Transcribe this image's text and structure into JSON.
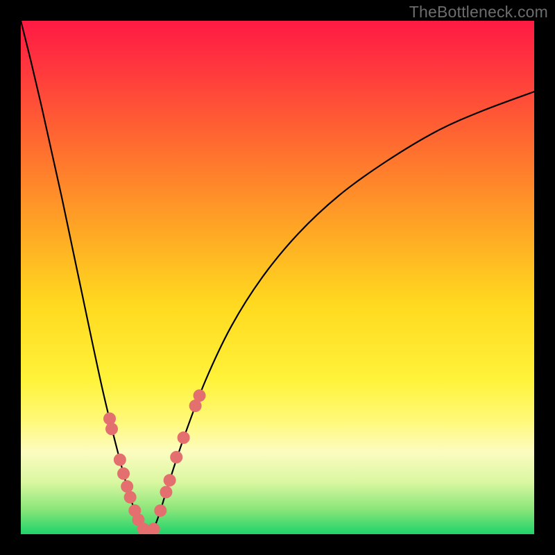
{
  "watermark": "TheBottleneck.com",
  "chart_data": {
    "type": "line",
    "title": "",
    "xlabel": "",
    "ylabel": "",
    "xlim": [
      0,
      1
    ],
    "ylim": [
      0,
      1
    ],
    "background_gradient": {
      "stops": [
        {
          "offset": 0.0,
          "color": "#ff1a44"
        },
        {
          "offset": 0.1,
          "color": "#ff3a3d"
        },
        {
          "offset": 0.25,
          "color": "#ff6f2f"
        },
        {
          "offset": 0.4,
          "color": "#ffa425"
        },
        {
          "offset": 0.55,
          "color": "#ffd91f"
        },
        {
          "offset": 0.7,
          "color": "#fff33a"
        },
        {
          "offset": 0.78,
          "color": "#fff97a"
        },
        {
          "offset": 0.84,
          "color": "#fcfcc0"
        },
        {
          "offset": 0.9,
          "color": "#d8f7a0"
        },
        {
          "offset": 0.95,
          "color": "#8de67a"
        },
        {
          "offset": 1.0,
          "color": "#1fd36b"
        }
      ]
    },
    "series": [
      {
        "name": "left-branch",
        "x": [
          0.0,
          0.02,
          0.04,
          0.06,
          0.08,
          0.1,
          0.12,
          0.14,
          0.16,
          0.18,
          0.2,
          0.21,
          0.222,
          0.234,
          0.245
        ],
        "y": [
          1.0,
          0.92,
          0.835,
          0.745,
          0.655,
          0.56,
          0.465,
          0.37,
          0.278,
          0.195,
          0.118,
          0.082,
          0.046,
          0.02,
          0.0
        ]
      },
      {
        "name": "right-branch",
        "x": [
          0.255,
          0.27,
          0.29,
          0.32,
          0.36,
          0.41,
          0.47,
          0.54,
          0.62,
          0.71,
          0.81,
          0.9,
          1.0
        ],
        "y": [
          0.0,
          0.04,
          0.105,
          0.195,
          0.3,
          0.405,
          0.5,
          0.585,
          0.66,
          0.725,
          0.785,
          0.825,
          0.862
        ]
      }
    ],
    "scatter": {
      "name": "markers",
      "color": "#e36f6f",
      "radius_px": 9,
      "points": [
        {
          "x": 0.173,
          "y": 0.225
        },
        {
          "x": 0.177,
          "y": 0.205
        },
        {
          "x": 0.193,
          "y": 0.145
        },
        {
          "x": 0.2,
          "y": 0.118
        },
        {
          "x": 0.207,
          "y": 0.093
        },
        {
          "x": 0.213,
          "y": 0.072
        },
        {
          "x": 0.222,
          "y": 0.046
        },
        {
          "x": 0.229,
          "y": 0.028
        },
        {
          "x": 0.239,
          "y": 0.01
        },
        {
          "x": 0.248,
          "y": 0.0
        },
        {
          "x": 0.259,
          "y": 0.01
        },
        {
          "x": 0.272,
          "y": 0.046
        },
        {
          "x": 0.283,
          "y": 0.082
        },
        {
          "x": 0.29,
          "y": 0.105
        },
        {
          "x": 0.303,
          "y": 0.15
        },
        {
          "x": 0.317,
          "y": 0.188
        },
        {
          "x": 0.34,
          "y": 0.25
        },
        {
          "x": 0.348,
          "y": 0.27
        }
      ]
    }
  }
}
